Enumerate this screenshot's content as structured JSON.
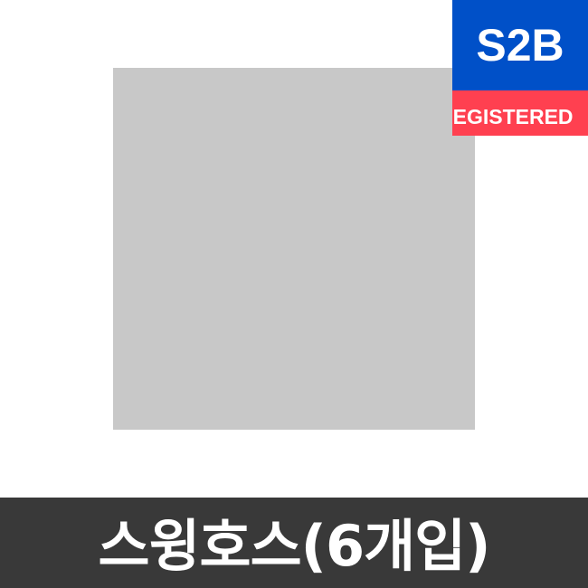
{
  "badge": {
    "title": "S2B",
    "subtitle": "REGISTERED",
    "top_color": "#0050c8",
    "bottom_color": "#ff4050"
  },
  "product": {
    "image_placeholder_color": "#c8c8c8"
  },
  "title_bar": {
    "text": "스윙호스(6개입)",
    "background_color": "#393939"
  }
}
